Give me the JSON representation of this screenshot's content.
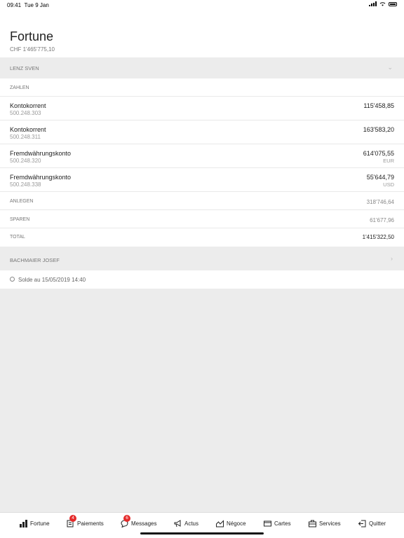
{
  "status": {
    "time": "09:41",
    "date": "Tue 9 Jan"
  },
  "header": {
    "title": "Fortune",
    "subtitle": "CHF 1'465'775,10"
  },
  "owner1": {
    "name": "LENZ SVEN",
    "group": "ZAHLEN",
    "accounts": [
      {
        "name": "Kontokorrent",
        "number": "500.248.303",
        "amount": "115'458,85",
        "currency": ""
      },
      {
        "name": "Kontokorrent",
        "number": "500.248.311",
        "amount": "163'583,20",
        "currency": ""
      },
      {
        "name": "Fremdwährungskonto",
        "number": "500.248.320",
        "amount": "614'075,55",
        "currency": "EUR"
      },
      {
        "name": "Fremdwährungskonto",
        "number": "500.248.338",
        "amount": "55'644,79",
        "currency": "USD"
      }
    ],
    "categories": [
      {
        "label": "ANLEGEN",
        "amount": "318'746,64"
      },
      {
        "label": "SPAREN",
        "amount": "61'677,96"
      }
    ],
    "total": {
      "label": "TOTAL",
      "amount": "1'415'322,50"
    }
  },
  "owner2": {
    "name": "BACHMAIER JOSEF"
  },
  "solde": "Solde au 15/05/2019 14:40",
  "tabs": [
    {
      "label": "Fortune",
      "icon": "bar-chart-icon"
    },
    {
      "label": "Paiements",
      "icon": "payment-icon",
      "badge": "4"
    },
    {
      "label": "Messages",
      "icon": "chat-icon",
      "badge": "6"
    },
    {
      "label": "Actus",
      "icon": "megaphone-icon"
    },
    {
      "label": "Négoce",
      "icon": "trend-icon"
    },
    {
      "label": "Cartes",
      "icon": "card-icon"
    },
    {
      "label": "Services",
      "icon": "briefcase-icon"
    },
    {
      "label": "Quitter",
      "icon": "logout-icon"
    }
  ],
  "colors": {
    "badge": "#e52a2a",
    "background": "#ececec"
  }
}
